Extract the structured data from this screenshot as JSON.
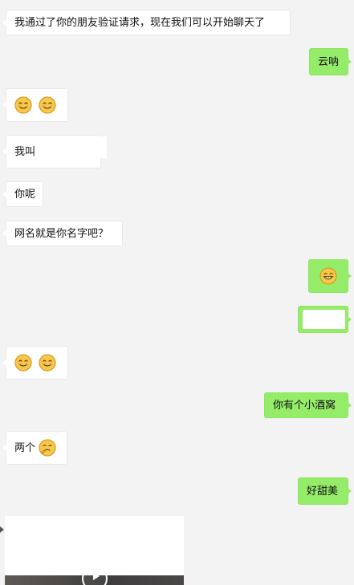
{
  "messages": [
    {
      "direction": "incoming",
      "text": "我通过了你的朋友验证请求，现在我们可以开始聊天了"
    },
    {
      "direction": "outgoing",
      "text": "云呐"
    },
    {
      "direction": "incoming",
      "emoji": [
        "smile-emoji",
        "smile-emoji"
      ]
    },
    {
      "direction": "incoming",
      "text": "我叫"
    },
    {
      "direction": "incoming",
      "text": "你呢"
    },
    {
      "direction": "incoming",
      "text": "网名就是你名字吧？"
    },
    {
      "direction": "outgoing",
      "emoji": [
        "grin-emoji"
      ]
    },
    {
      "direction": "outgoing",
      "text": ""
    },
    {
      "direction": "incoming",
      "emoji": [
        "smile-emoji",
        "smile-emoji"
      ]
    },
    {
      "direction": "outgoing",
      "text": "你有个小酒窝"
    },
    {
      "direction": "incoming",
      "text": "两个",
      "emoji": [
        "thinking-emoji"
      ]
    },
    {
      "direction": "outgoing",
      "text": "好甜美"
    },
    {
      "direction": "incoming",
      "media": "video-message"
    }
  ],
  "colors": {
    "background": "#f3f3f3",
    "incoming_bubble": "#ffffff",
    "outgoing_bubble": "#95ec69",
    "emoji_face": "#f7c84b",
    "emoji_outline": "#d99a1e"
  }
}
